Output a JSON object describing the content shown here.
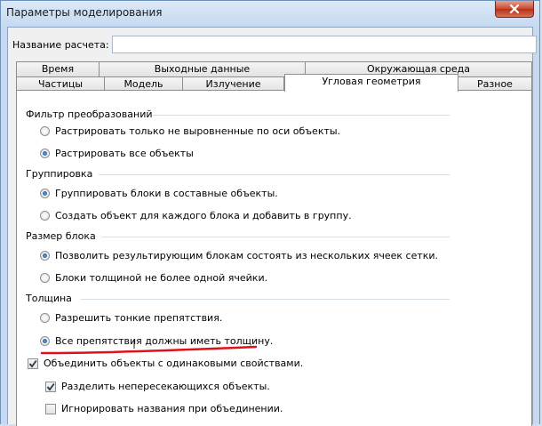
{
  "window": {
    "title": "Параметры моделирования"
  },
  "calc": {
    "label": "Название расчета:",
    "value": ""
  },
  "tabs_back": [
    {
      "label": "Время"
    },
    {
      "label": "Выходные данные"
    },
    {
      "label": "Окружающая среда"
    }
  ],
  "tabs_front": [
    {
      "label": "Частицы"
    },
    {
      "label": "Модель"
    },
    {
      "label": "Излучение"
    },
    {
      "label": "Угловая геометрия",
      "active": true
    },
    {
      "label": "Разное"
    }
  ],
  "groups": {
    "filter": {
      "label": "Фильтр преобразований",
      "options": [
        {
          "label": "Растрировать только не выровненные по оси объекты.",
          "selected": false
        },
        {
          "label": "Растрировать все объекты",
          "selected": true
        }
      ]
    },
    "grouping": {
      "label": "Группировка",
      "options": [
        {
          "label": "Группировать блоки в составные объекты.",
          "selected": true
        },
        {
          "label": "Создать объект для каждого блока и добавить в группу.",
          "selected": false
        }
      ]
    },
    "block_size": {
      "label": "Размер блока",
      "options": [
        {
          "label": "Позволить результирующим блокам состоять из нескольких ячеек сетки.",
          "selected": true
        },
        {
          "label": "Блоки толщиной не более одной ячейки.",
          "selected": false
        }
      ]
    },
    "thickness": {
      "label": "Толщина",
      "options": [
        {
          "label": "Разрешить тонкие препятствия.",
          "selected": false
        },
        {
          "label": "Все препятствия должны иметь толщину.",
          "selected": true
        }
      ]
    }
  },
  "checks": [
    {
      "label": "Объединить объекты с одинаковыми свойствами.",
      "checked": true
    },
    {
      "label": "Разделить непересекающихся объекты.",
      "checked": true
    },
    {
      "label": "Игнорировать названия при объединении.",
      "checked": false
    }
  ],
  "colors": {
    "annotation": "#e0101a",
    "radio_dot": "#1f63a8",
    "check_mark": "#2a3a4e"
  }
}
